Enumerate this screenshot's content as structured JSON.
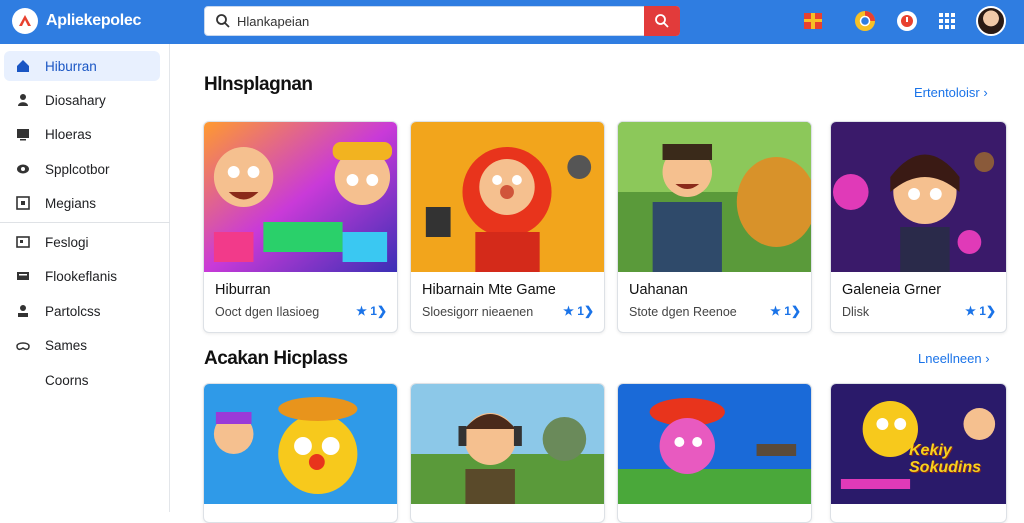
{
  "app": {
    "brand": "Apliekepolec"
  },
  "search": {
    "value": "Hlankapeian",
    "placeholder": ""
  },
  "sidebar": {
    "items": [
      {
        "label": "Hiburran",
        "icon": "home-icon",
        "active": true
      },
      {
        "label": "Diosahary",
        "icon": "person-icon"
      },
      {
        "label": "Hloeras",
        "icon": "tv-icon"
      },
      {
        "label": "Spplcotbor",
        "icon": "eye-icon"
      },
      {
        "label": "Megians",
        "icon": "monitor-icon"
      },
      {
        "label": "Feslogi",
        "icon": "gamepad-icon"
      },
      {
        "label": "Flookeflanis",
        "icon": "keyboard-icon"
      },
      {
        "label": "Partolcss",
        "icon": "joystick-icon"
      },
      {
        "label": "Sames",
        "icon": "controller-icon"
      },
      {
        "label": "Coorns",
        "icon": ""
      }
    ]
  },
  "section1": {
    "title": "Hlnsplagnan",
    "link": "Ertentoloisr",
    "cards": [
      {
        "title": "Hiburran",
        "subtitle": "Ooct dgen Ilasioeg",
        "rating": "★ 1❯"
      },
      {
        "title": "Hibarnain Mte Game",
        "subtitle": "Sloesigorr nieaenen",
        "rating": "★ 1❯"
      },
      {
        "title": "Uahanan",
        "subtitle": "Stote dgen Reenoe",
        "rating": "★ 1❯"
      },
      {
        "title": "Galeneia Grner",
        "subtitle": "Dlisk",
        "rating": "★ 1❯"
      }
    ]
  },
  "section2": {
    "title": "Acakan Hicplass",
    "link": "Lneellneen",
    "cards": [
      {
        "title": ""
      },
      {
        "title": ""
      },
      {
        "title": ""
      },
      {
        "title": "Kekiy Sokudins"
      }
    ]
  },
  "colors": {
    "topbar": "#2f7de1",
    "accent": "#1a73e8",
    "search_button": "#e23b3b"
  }
}
